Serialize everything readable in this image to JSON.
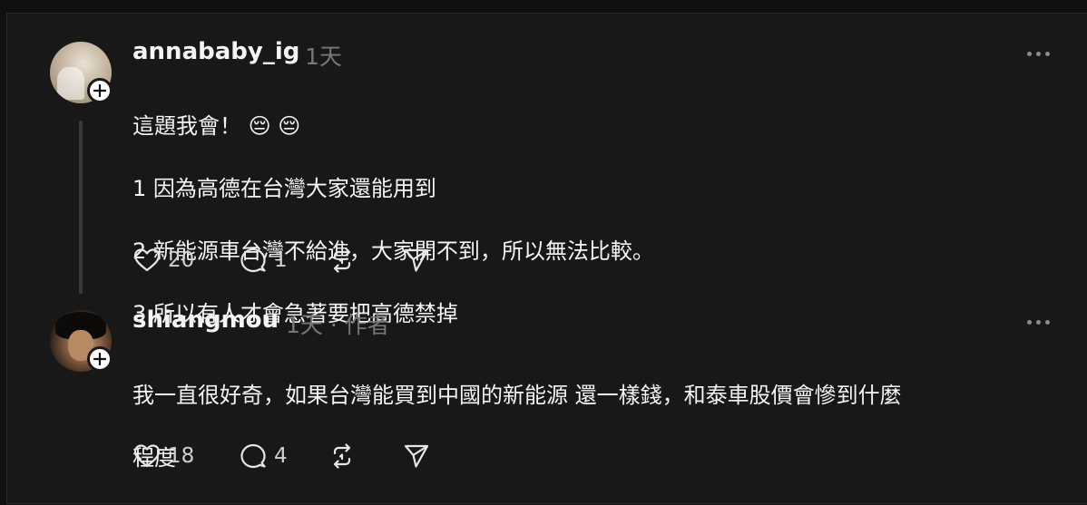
{
  "posts": [
    {
      "username": "annababy_ig",
      "time": "1天",
      "role": "",
      "lines": [
        "這題我會！ 😔 😔",
        "1 因為高德在台灣大家還能用到",
        "2 新能源車台灣不給進，大家開不到，所以無法比較。",
        "3 所以有人才會急著要把高德禁掉"
      ],
      "likes": "20",
      "replies": "1"
    },
    {
      "username": "shiangmou",
      "time": "1天",
      "role": "· 作者",
      "lines": [
        "我一直很好奇，如果台灣能買到中國的新能源 還一樣錢，和泰車股價會慘到什麼",
        "程度"
      ],
      "likes": "18",
      "replies": "4"
    }
  ],
  "icons": {
    "like": "heart-icon",
    "reply": "comment-icon",
    "repost": "repost-icon",
    "share": "send-icon",
    "more": "more-icon",
    "follow": "plus-icon"
  },
  "colors": {
    "background": "#101010",
    "panel": "#181818",
    "text": "#f3f5f7",
    "muted": "#777777"
  }
}
